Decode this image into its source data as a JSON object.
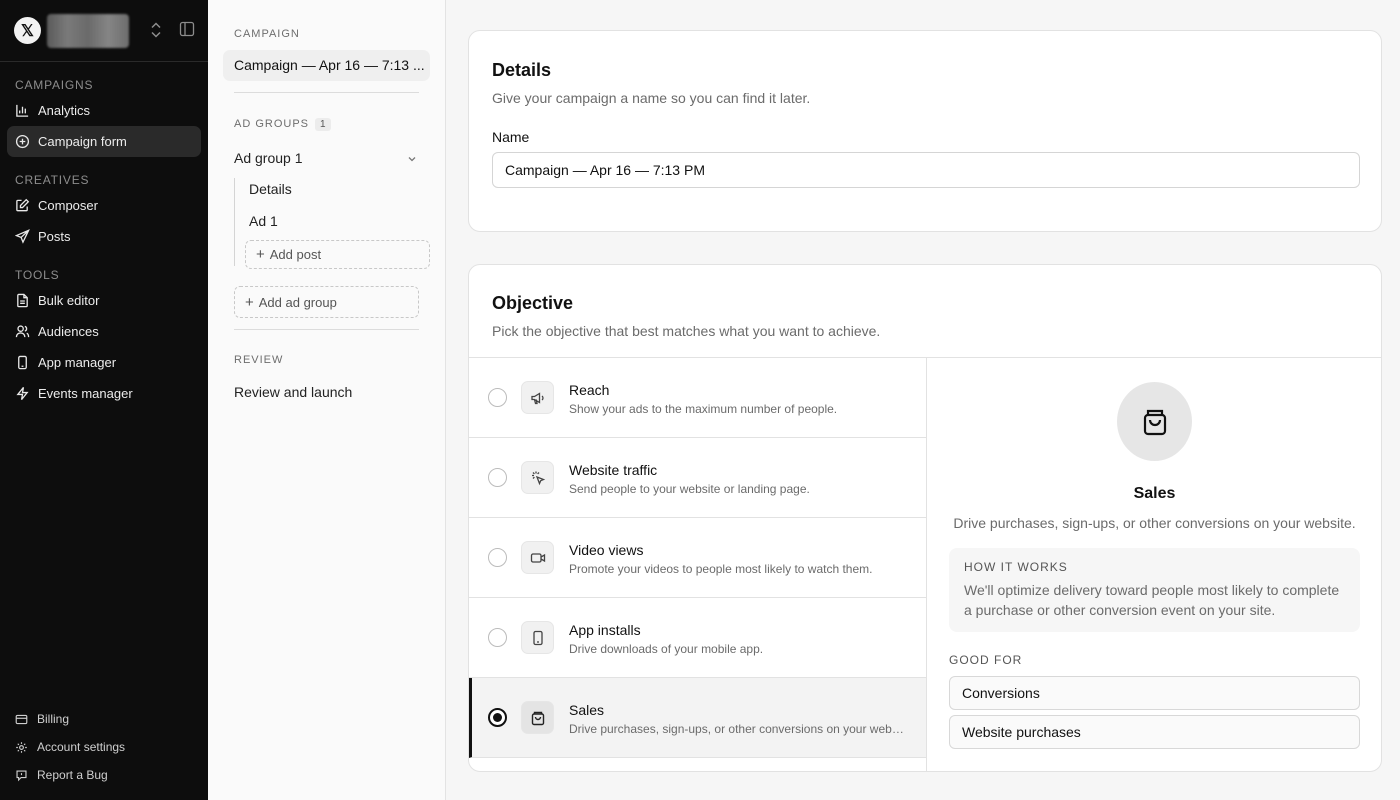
{
  "sidebar": {
    "logo": "𝕏",
    "sections": [
      {
        "title": "CAMPAIGNS",
        "items": [
          {
            "label": "Analytics",
            "icon": "bar-chart-icon"
          },
          {
            "label": "Campaign form",
            "icon": "plus-circle-icon",
            "active": true
          }
        ]
      },
      {
        "title": "CREATIVES",
        "items": [
          {
            "label": "Composer",
            "icon": "edit-icon"
          },
          {
            "label": "Posts",
            "icon": "send-icon"
          }
        ]
      },
      {
        "title": "TOOLS",
        "items": [
          {
            "label": "Bulk editor",
            "icon": "file-icon"
          },
          {
            "label": "Audiences",
            "icon": "users-icon"
          },
          {
            "label": "App manager",
            "icon": "phone-icon"
          },
          {
            "label": "Events manager",
            "icon": "bolt-icon"
          }
        ]
      }
    ],
    "bottom": [
      {
        "label": "Billing",
        "icon": "card-icon"
      },
      {
        "label": "Account settings",
        "icon": "gear-icon"
      },
      {
        "label": "Report a Bug",
        "icon": "flag-icon"
      }
    ]
  },
  "nav2": {
    "campaign_section": "CAMPAIGN",
    "campaign_name": "Campaign — Apr 16 — 7:13 ...",
    "ad_groups_section": "AD GROUPS",
    "ad_groups_count": "1",
    "ad_group_name": "Ad group 1",
    "ad_group_children": [
      "Details",
      "Ad 1"
    ],
    "add_post": "Add post",
    "add_ad_group": "Add ad group",
    "review_section": "REVIEW",
    "review_item": "Review and launch"
  },
  "details": {
    "title": "Details",
    "subtitle": "Give your campaign a name so you can find it later.",
    "name_label": "Name",
    "name_value": "Campaign — Apr 16 — 7:13 PM"
  },
  "objective": {
    "title": "Objective",
    "subtitle": "Pick the objective that best matches what you want to achieve.",
    "options": [
      {
        "title": "Reach",
        "desc": "Show your ads to the maximum number of people.",
        "icon": "megaphone-icon"
      },
      {
        "title": "Website traffic",
        "desc": "Send people to your website or landing page.",
        "icon": "cursor-click-icon"
      },
      {
        "title": "Video views",
        "desc": "Promote your videos to people most likely to watch them.",
        "icon": "video-icon"
      },
      {
        "title": "App installs",
        "desc": "Drive downloads of your mobile app.",
        "icon": "phone-icon"
      },
      {
        "title": "Sales",
        "desc": "Drive purchases, sign-ups, or other conversions on your website.",
        "icon": "shopping-bag-icon",
        "selected": true
      }
    ],
    "selected_detail": {
      "title": "Sales",
      "desc": "Drive purchases, sign-ups, or other conversions on your website.",
      "how_heading": "HOW IT WORKS",
      "how_text": "We'll optimize delivery toward people most likely to complete a purchase or other conversion event on your site.",
      "good_for_heading": "GOOD FOR",
      "good_for": [
        "Conversions",
        "Website purchases"
      ]
    }
  }
}
